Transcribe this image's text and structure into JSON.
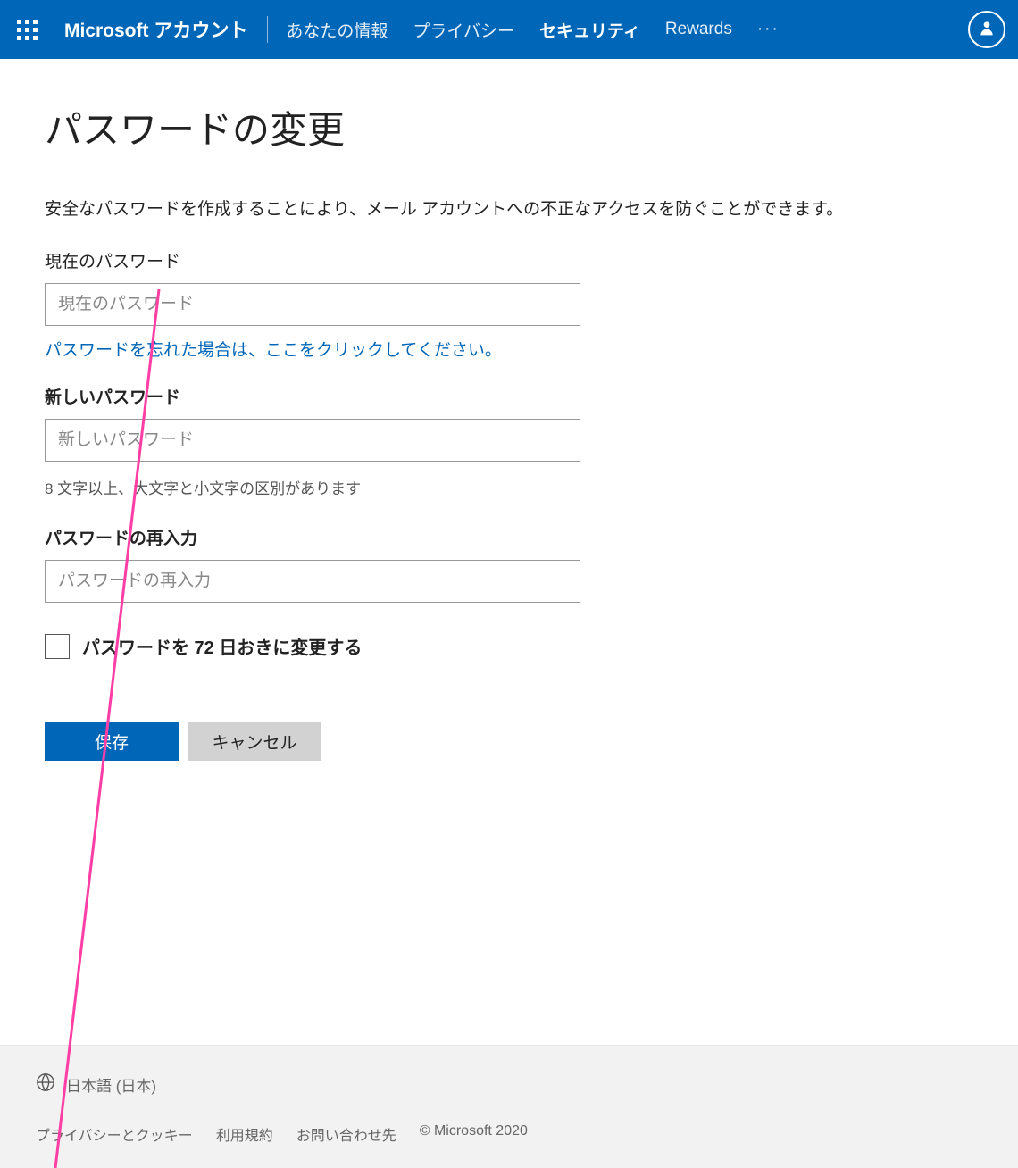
{
  "header": {
    "brand": "Microsoft アカウント",
    "nav": [
      {
        "label": "あなたの情報",
        "active": false
      },
      {
        "label": "プライバシー",
        "active": false
      },
      {
        "label": "セキュリティ",
        "active": true
      },
      {
        "label": "Rewards",
        "active": false
      }
    ],
    "more": "···"
  },
  "page": {
    "title": "パスワードの変更",
    "subtitle": "安全なパスワードを作成することにより、メール アカウントへの不正なアクセスを防ぐことができます。"
  },
  "form": {
    "current": {
      "label": "現在のパスワード",
      "placeholder": "現在のパスワード",
      "forgot_link": "パスワードを忘れた場合は、ここをクリックしてください。"
    },
    "new": {
      "label": "新しいパスワード",
      "placeholder": "新しいパスワード",
      "hint": "8 文字以上、大文字と小文字の区別があります"
    },
    "confirm": {
      "label": "パスワードの再入力",
      "placeholder": "パスワードの再入力"
    },
    "rotate_checkbox": {
      "label": "パスワードを 72 日おきに変更する",
      "checked": false
    },
    "buttons": {
      "save": "保存",
      "cancel": "キャンセル"
    }
  },
  "footer": {
    "locale": "日本語 (日本)",
    "links": {
      "privacy": "プライバシーとクッキー",
      "terms": "利用規約",
      "contact": "お問い合わせ先"
    },
    "copyright": "© Microsoft 2020"
  }
}
